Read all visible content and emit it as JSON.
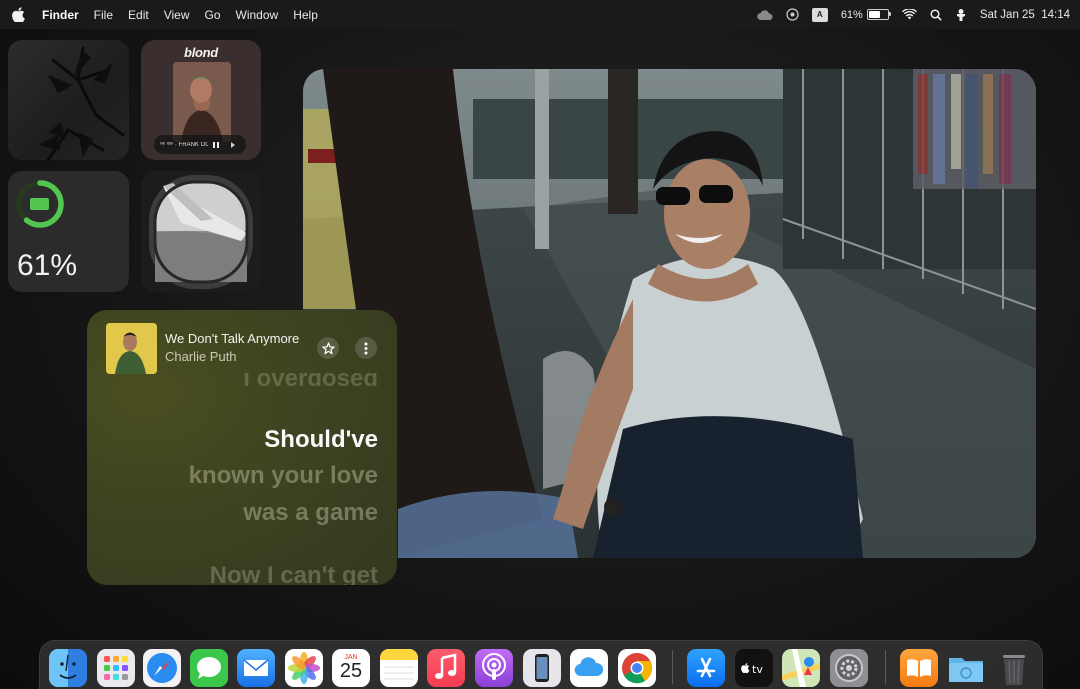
{
  "menubar": {
    "app_name": "Finder",
    "menus": [
      "File",
      "Edit",
      "View",
      "Go",
      "Window",
      "Help"
    ],
    "status": {
      "battery_percent": "61%",
      "battery_level": 0.61,
      "input_source": "A",
      "datetime": "Sat Jan 25  14:14"
    }
  },
  "widgets": {
    "album": {
      "title": "blond",
      "mini_title": "ᵛᶦᵉ ᴵᵈᵒˡ · FRANK OCEAN"
    },
    "battery": {
      "label": "61%",
      "level": 0.61,
      "ring_color": "#52c64e"
    }
  },
  "lyrics": {
    "song_title": "We Don't Talk Anymore",
    "artist": "Charlie Puth",
    "previous_line": "I overdosed",
    "current_line": "Should've",
    "next_line_1": "known your love",
    "next_line_2": "was a game",
    "next_line_3": "Now I can't get"
  },
  "dock": {
    "calendar": {
      "month": "JAN",
      "day": "25"
    },
    "apps": [
      "Finder",
      "Launchpad",
      "Safari",
      "Messages",
      "Mail",
      "Photos",
      "Calendar",
      "Notes",
      "Music",
      "Podcasts",
      "iPhone Mirroring",
      "iCloud Drive",
      "Google Chrome",
      "App Store",
      "Apple TV",
      "Maps",
      "System Settings",
      "Books",
      "Downloads",
      "Trash"
    ]
  }
}
